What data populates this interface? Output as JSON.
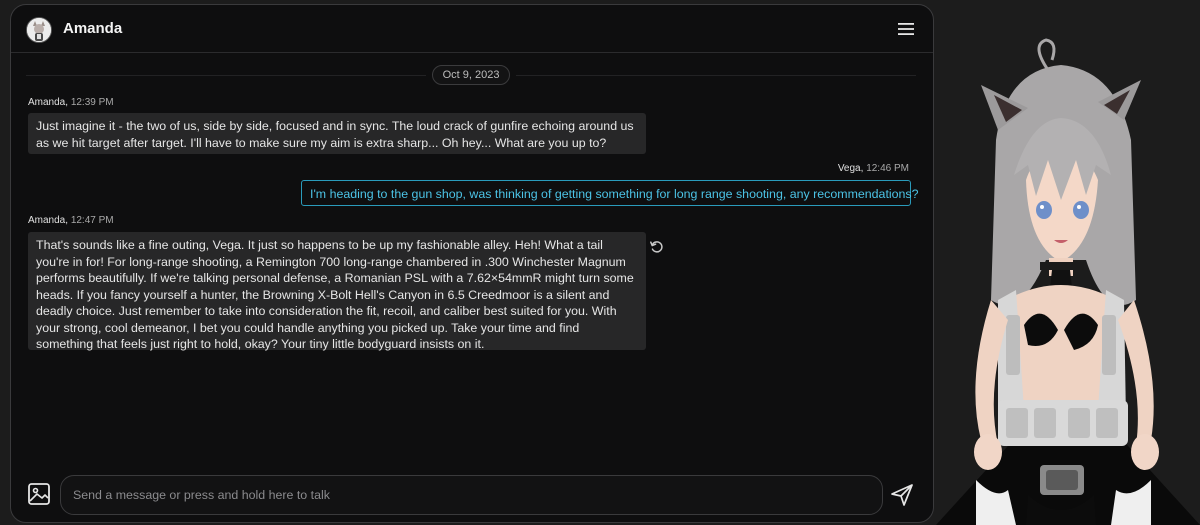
{
  "header": {
    "name": "Amanda",
    "menu_icon": "hamburger-menu-icon"
  },
  "date_separator": "Oct 9, 2023",
  "messages": [
    {
      "sender": "Amanda,",
      "time": "12:39 PM",
      "text": "Just imagine it - the two of us, side by side, focused and in sync. The loud crack of gunfire echoing around us as we hit target after target. I'll have to make sure my aim is extra sharp... Oh hey... What are you up to?"
    },
    {
      "sender": "Vega,",
      "time": "12:46 PM",
      "text": "I'm heading to the gun shop, was thinking of getting something for long range shooting, any recommendations?"
    },
    {
      "sender": "Amanda,",
      "time": "12:47 PM",
      "text": "That's sounds like a fine outing, Vega. It just so happens to be up my fashionable alley. Heh! What a tail you're in for! For long-range shooting, a Remington 700 long-range chambered in .300 Winchester Magnum performs beautifully. If we're talking personal defense, a Romanian PSL with a 7.62×54mmR might turn some heads. If you fancy yourself a hunter, the Browning X-Bolt Hell's Canyon in 6.5 Creedmoor is a silent and deadly choice. Just remember to take into consideration the fit, recoil, and caliber best suited for you. With your strong, cool demeanor, I bet you could handle anything you picked up. Take your time and find something that feels just right to hold, okay? Your tiny little bodyguard insists on it."
    }
  ],
  "composer": {
    "placeholder": "Send a message or press and hold here to talk",
    "value": "",
    "image_icon": "image-icon",
    "send_icon": "send-icon"
  },
  "colors": {
    "panel_bg": "#0e0e0f",
    "bubble_bg": "#272728",
    "user_accent": "#2a9bbb",
    "user_text": "#4cc3e6"
  }
}
